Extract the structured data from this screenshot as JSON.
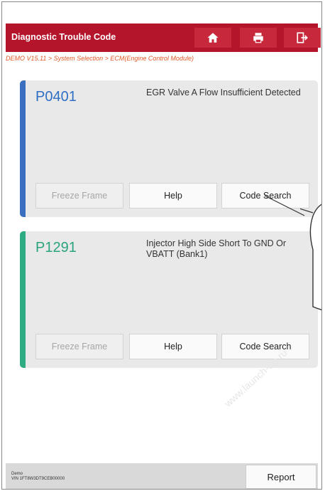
{
  "header": {
    "title": "Diagnostic Trouble Code",
    "home_icon": "home-icon",
    "print_icon": "print-icon",
    "exit_icon": "exit-icon",
    "bg_color": "#b5152b"
  },
  "breadcrumb": "DEMO V15.11 > System Selection > ECM(Engine Control Module)",
  "codes": [
    {
      "code": "P0401",
      "description": "EGR Valve A Flow Insufficient Detected",
      "stripe_color": "#3a6fc0",
      "buttons": {
        "freeze_frame": "Freeze Frame",
        "help": "Help",
        "code_search": "Code Search"
      }
    },
    {
      "code": "P1291",
      "description": "Injector High Side Short To GND Or VBATT (Bank1)",
      "stripe_color": "#2fab84",
      "buttons": {
        "freeze_frame": "Freeze Frame",
        "help": "Help",
        "code_search": "Code Search"
      }
    }
  ],
  "footer": {
    "line1": "Demo",
    "line2": "VIN 1FT8W3DT9CEB00000",
    "report_label": "Report"
  },
  "watermark": "www.launch-cis.ru"
}
